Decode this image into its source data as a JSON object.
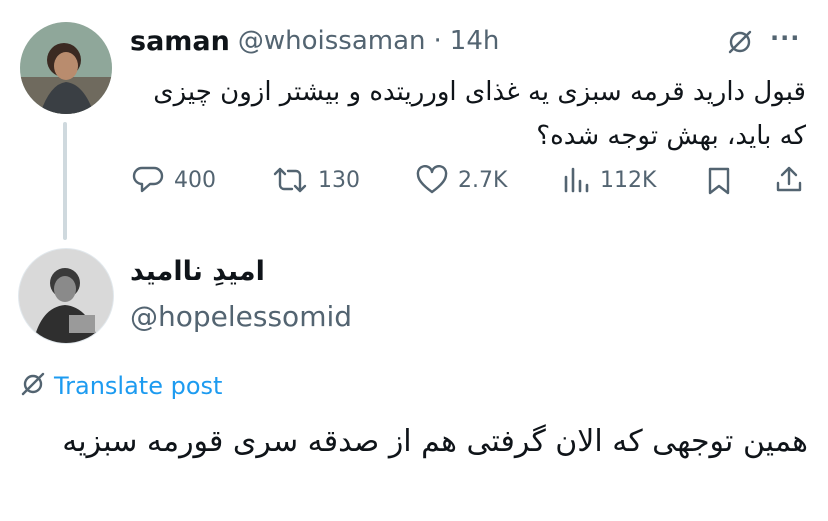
{
  "tweet": {
    "author_name": "saman",
    "handle": "@whoissaman",
    "separator": "·",
    "time": "14h",
    "more_label": "···",
    "text": "قبول دارید قرمه سبزی یه غذای اورریتده و بیشتر ازون چیزی که باید، بهش توجه شده؟",
    "actions": {
      "replies": "400",
      "retweets": "130",
      "likes": "2.7K",
      "views": "112K"
    }
  },
  "reply": {
    "author_name": "امیدِ ناامید",
    "handle": "@hopelessomid",
    "translate_label": "Translate post",
    "text": "همین توجهی که الان گرفتی هم از صدقه سری قورمه سبزیه"
  },
  "icons": {
    "reply": "reply-icon",
    "retweet": "retweet-icon",
    "like": "heart-icon",
    "views": "views-icon",
    "bookmark": "bookmark-icon",
    "share": "share-icon",
    "grok": "grok-icon",
    "translate": "translate-icon"
  },
  "colors": {
    "text": "#0f1419",
    "muted": "#536471",
    "link": "#1d9bf0",
    "thread_line": "#cfd9de"
  }
}
